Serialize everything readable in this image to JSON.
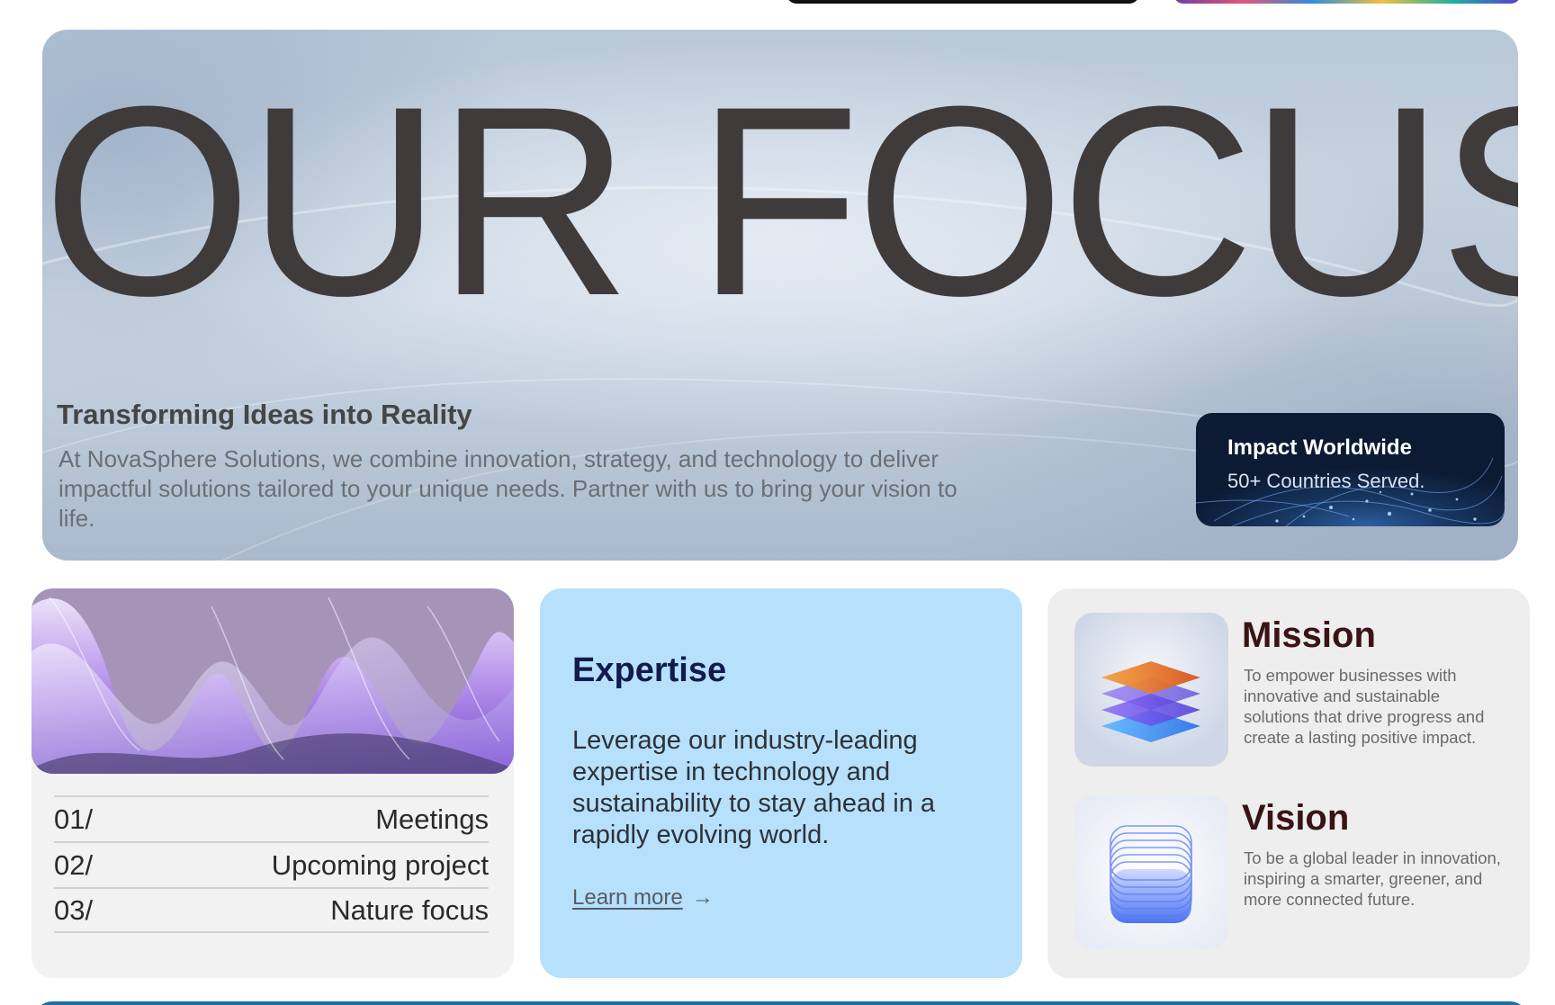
{
  "hero": {
    "title": "OUR FOCUS",
    "subtitle": "Transforming Ideas into Reality",
    "description": "At NovaSphere Solutions, we combine innovation, strategy, and technology to deliver impactful solutions tailored to your unique needs. Partner with us to bring your vision to life."
  },
  "impact": {
    "title": "Impact Worldwide",
    "subtitle": "50+ Countries Served."
  },
  "focus_list": {
    "items": [
      {
        "number": "01/",
        "label": "Meetings"
      },
      {
        "number": "02/",
        "label": "Upcoming project"
      },
      {
        "number": "03/",
        "label": "Nature focus"
      }
    ]
  },
  "expertise": {
    "title": "Expertise",
    "body": "Leverage our industry-leading expertise in technology and sustainability to stay ahead in a rapidly evolving world.",
    "link_label": "Learn more",
    "link_arrow": "→"
  },
  "mission": {
    "title": "Mission",
    "description": "To empower businesses with innovative and sustainable solutions that drive progress and create a lasting positive impact."
  },
  "vision": {
    "title": "Vision",
    "description": "To be a global leader in innovation, inspiring a smarter, greener, and more connected future."
  },
  "colors": {
    "expertise_bg": "#b6e0fb",
    "expertise_title": "#131b4e",
    "impact_bg": "#0c1a33",
    "bottom_bar": "#1d6ea7"
  }
}
